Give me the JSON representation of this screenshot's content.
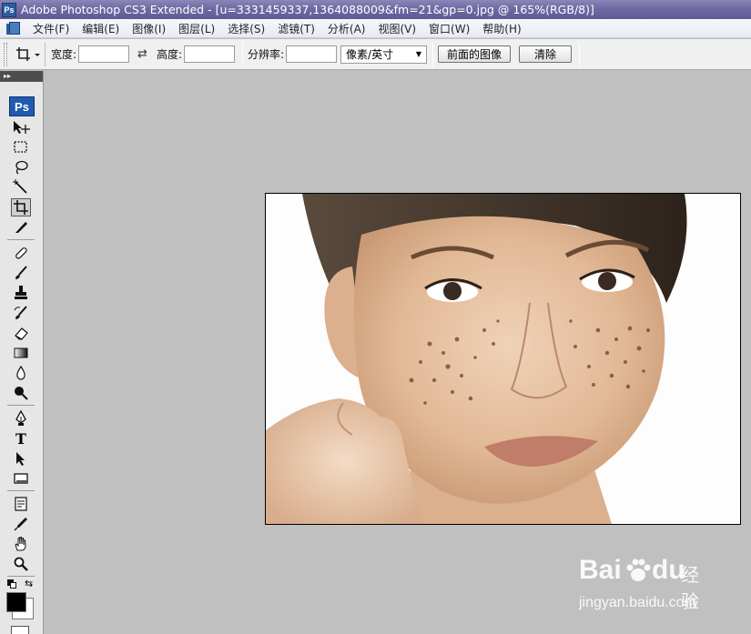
{
  "window": {
    "title": "Adobe Photoshop CS3 Extended - [u=3331459337,1364088009&fm=21&gp=0.jpg @ 165%(RGB/8)]",
    "app_icon_text": "Ps"
  },
  "menu": {
    "items": [
      "文件(F)",
      "编辑(E)",
      "图像(I)",
      "图层(L)",
      "选择(S)",
      "滤镜(T)",
      "分析(A)",
      "视图(V)",
      "窗口(W)",
      "帮助(H)"
    ]
  },
  "options": {
    "width_label": "宽度:",
    "width_value": "",
    "height_label": "高度:",
    "height_value": "",
    "resolution_label": "分辨率:",
    "resolution_value": "",
    "unit_select": "像素/英寸",
    "front_image_button": "前面的图像",
    "clear_button": "清除",
    "active_tool_icon": "crop-icon"
  },
  "toolbox": {
    "badge": "Ps",
    "tools": [
      "move-icon",
      "marquee-icon",
      "lasso-icon",
      "magic-wand-icon",
      "crop-icon",
      "slice-icon",
      "healing-icon",
      "brush-icon",
      "stamp-icon",
      "history-brush-icon",
      "eraser-icon",
      "gradient-icon",
      "blur-icon",
      "dodge-icon",
      "pen-icon",
      "type-icon",
      "path-select-icon",
      "shape-icon",
      "notes-icon",
      "eyedropper-icon",
      "hand-icon",
      "zoom-icon"
    ],
    "foreground_color": "#000000",
    "background_color": "#ffffff"
  },
  "document": {
    "zoom": "165%",
    "mode": "RGB/8"
  },
  "watermark": {
    "brand": "Bai",
    "brand2": "du",
    "brand_cn": "经验",
    "url": "jingyan.baidu.com"
  }
}
